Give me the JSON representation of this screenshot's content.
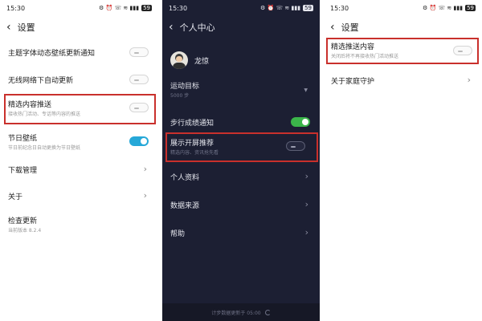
{
  "status_bar": {
    "time": "15:30",
    "icons": "⚙ ⏰ ☏ ≋ ▮▮▮",
    "battery": "59"
  },
  "panel_left": {
    "title": "设置",
    "items": [
      {
        "label": "主题字体动态壁纸更新通知",
        "toggle": "off"
      },
      {
        "label": "无线网络下自动更新",
        "toggle": "off"
      },
      {
        "label": "精选内容推送",
        "sub": "接收热门活动、专话等内容的推送",
        "toggle": "off",
        "highlighted": true
      },
      {
        "label": "节日壁纸",
        "sub": "节日前纪念日自动更换为节日壁纸",
        "toggle": "on"
      },
      {
        "label": "下载管理"
      },
      {
        "label": "关于"
      },
      {
        "label": "检查更新",
        "sub": "当前版本 8.2.4"
      }
    ]
  },
  "panel_middle": {
    "title": "个人中心",
    "username": "龙惊",
    "items": [
      {
        "label": "运动目标",
        "sub": "5000 步"
      },
      {
        "label": "步行成绩通知",
        "toggle": "on"
      },
      {
        "label": "展示开屏推荐",
        "sub": "精选内容、资讯抢先看",
        "toggle": "off",
        "highlighted": true
      },
      {
        "label": "个人资料"
      },
      {
        "label": "数据来源"
      },
      {
        "label": "帮助"
      }
    ],
    "footer": "计步数据更新于 05:00"
  },
  "panel_right": {
    "title": "设置",
    "items": [
      {
        "label": "精选推送内容",
        "sub": "关闭后将不再接收热门活动推送",
        "toggle": "off",
        "highlighted": true
      },
      {
        "label": "关于家庭守护"
      }
    ]
  },
  "colors": {
    "highlight": "#c9302c",
    "toggle_on_blue": "#26a8d8",
    "toggle_on_green": "#3bb54a",
    "dark_background": "#1c1f33"
  }
}
